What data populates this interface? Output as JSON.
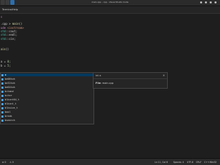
{
  "window": {
    "title": "main.cpp - cpp - Visual Studio Code"
  },
  "menu": {
    "items": [
      "Terminal",
      "Help"
    ]
  },
  "editor": {
    "lines": [
      {
        "a": "s"
      },
      {
        "a": ".cpp",
        "b": " > ",
        "c": "main()"
      },
      {
        "a": "ude ",
        "b": "<iostream>"
      },
      {
        "a": "std",
        "b": "::",
        "c": "cout",
        "d": ";"
      },
      {
        "a": "std",
        "b": "::",
        "c": "endl",
        "d": ";"
      },
      {
        "a": "std",
        "b": "::",
        "c": "cin",
        "d": ";"
      },
      {
        "a": "ain",
        "b": "()"
      },
      {
        "a": "a ",
        "b": "= ",
        "c": "0",
        "d": ";"
      },
      {
        "a": "b ",
        "b": "= ",
        "c": "5",
        "d": ";"
      },
      {
        "a": "a"
      }
    ]
  },
  "suggest": {
    "items": [
      "a",
      "be08toh",
      "be32toh",
      "be64toh",
      "bitand",
      "bitor",
      "blkcnt64_t",
      "blkcnt_t",
      "blksize_t",
      "bool",
      "break",
      "bsearch"
    ]
  },
  "detail": {
    "header": "int a",
    "file_label": "File:",
    "file_value": "main.cpp"
  },
  "status": {
    "left": [
      "⊗ 0",
      "⚠ 0"
    ],
    "right": [
      "Ln 11, Col 6",
      "Spaces: 4",
      "UTF-8",
      "CRLF",
      "C++",
      "Win32"
    ]
  },
  "colors": {
    "accent": "#2a6fb0",
    "selection": "#04395e",
    "background": "#1e1e1e"
  }
}
